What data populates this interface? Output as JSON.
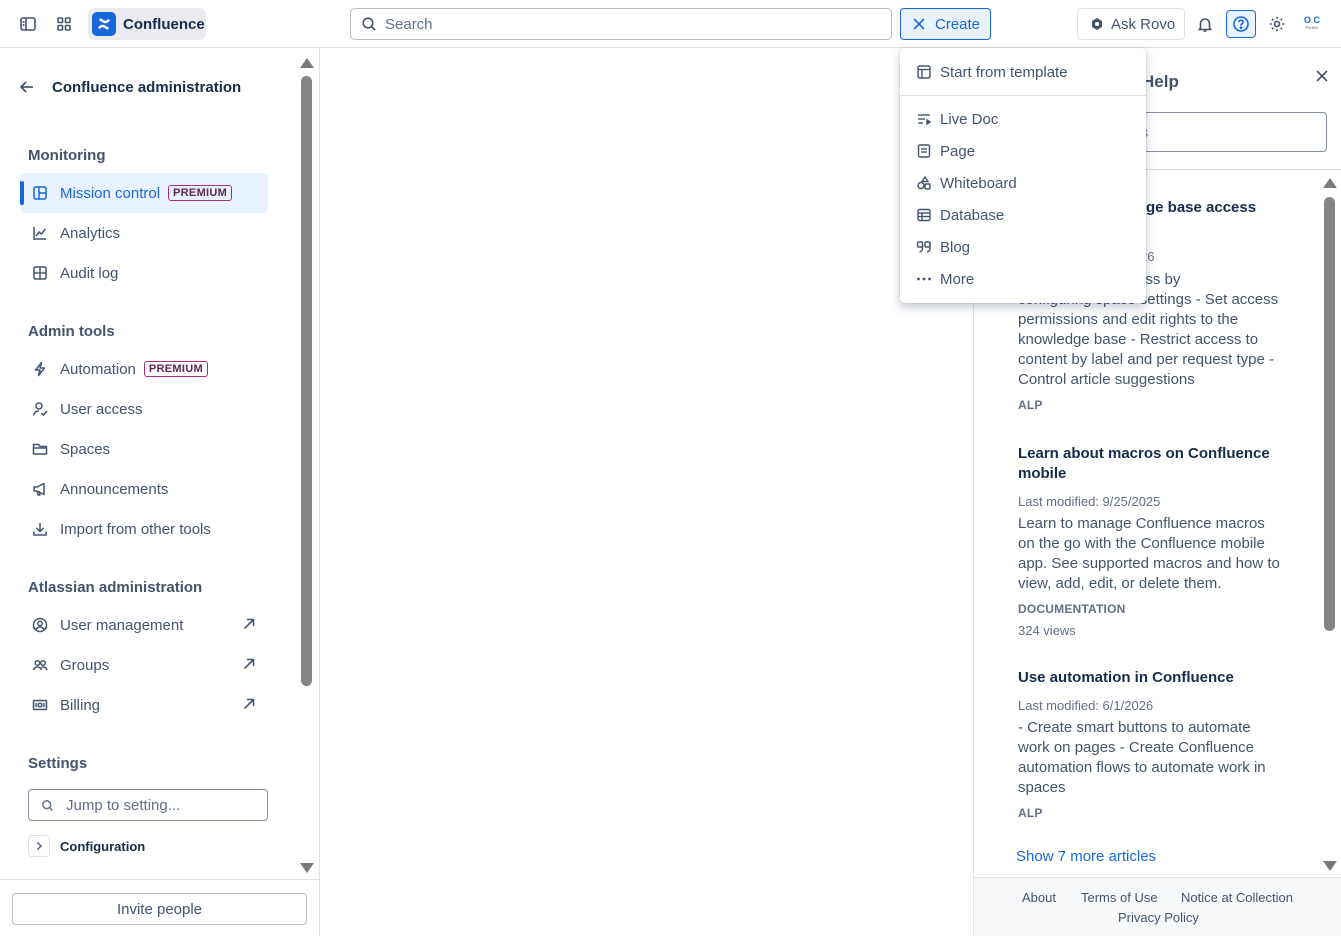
{
  "topbar": {
    "app_name": "Confluence",
    "search_placeholder": "Search",
    "create_label": "Create",
    "rovo_label": "Ask Rovo",
    "avatar_initials": "O C",
    "avatar_subtext": "FUNC"
  },
  "sidebar": {
    "title": "Confluence administration",
    "sections": {
      "monitoring": "Monitoring",
      "admin_tools": "Admin tools",
      "atlassian_admin": "Atlassian administration",
      "settings": "Settings"
    },
    "items": [
      {
        "label": "Mission control",
        "badge": "PREMIUM",
        "icon": "dashboard-icon",
        "active": true
      },
      {
        "label": "Analytics",
        "icon": "chart-line-icon"
      },
      {
        "label": "Audit log",
        "icon": "table-icon"
      },
      {
        "label": "Automation",
        "badge": "PREMIUM",
        "icon": "lightning-icon"
      },
      {
        "label": "User access",
        "icon": "person-check-icon"
      },
      {
        "label": "Spaces",
        "icon": "folder-icon"
      },
      {
        "label": "Announcements",
        "icon": "megaphone-icon"
      },
      {
        "label": "Import from other tools",
        "icon": "download-icon"
      },
      {
        "label": "User management",
        "icon": "person-circle-icon",
        "external": true
      },
      {
        "label": "Groups",
        "icon": "people-icon",
        "external": true
      },
      {
        "label": "Billing",
        "icon": "billing-icon",
        "external": true
      }
    ],
    "jump_placeholder": "Jump to setting...",
    "configuration_label": "Configuration",
    "invite_label": "Invite people"
  },
  "create_menu": {
    "template_label": "Start from template",
    "items": [
      {
        "label": "Live Doc",
        "icon": "live-doc-icon"
      },
      {
        "label": "Page",
        "icon": "page-icon"
      },
      {
        "label": "Whiteboard",
        "icon": "whiteboard-icon"
      },
      {
        "label": "Database",
        "icon": "database-icon"
      },
      {
        "label": "Blog",
        "icon": "quote-icon"
      },
      {
        "label": "More",
        "icon": "more-icon"
      }
    ]
  },
  "help_panel": {
    "title": "Help",
    "search_partial": "s",
    "articles": [
      {
        "title_partial": "ge base access",
        "meta_partial": "26",
        "desc_line1_partial": "ccess by",
        "desc_rest": "configuring space settings - Set access permissions and edit rights to the knowledge base - Restrict access to content by label and per request type - Control article suggestions",
        "tag": "ALP"
      },
      {
        "title": "Learn about macros on Confluence mobile",
        "meta": "Last modified: 9/25/2025",
        "desc": "Learn to manage Confluence macros on the go with the Confluence mobile app. See supported macros and how to view, add, edit, or delete them.",
        "tag": "DOCUMENTATION",
        "views": "324 views"
      },
      {
        "title": "Use automation in Confluence",
        "meta": "Last modified: 6/1/2026",
        "desc": "- Create smart buttons to automate work on pages - Create Confluence automation flows to automate work in spaces",
        "tag": "ALP"
      }
    ],
    "show_more": "Show 7 more articles",
    "footer": {
      "about": "About",
      "terms": "Terms of Use",
      "notice": "Notice at Collection",
      "privacy": "Privacy Policy"
    }
  },
  "colors": {
    "accent": "#1868db",
    "premium_border": "#ae2e86"
  }
}
